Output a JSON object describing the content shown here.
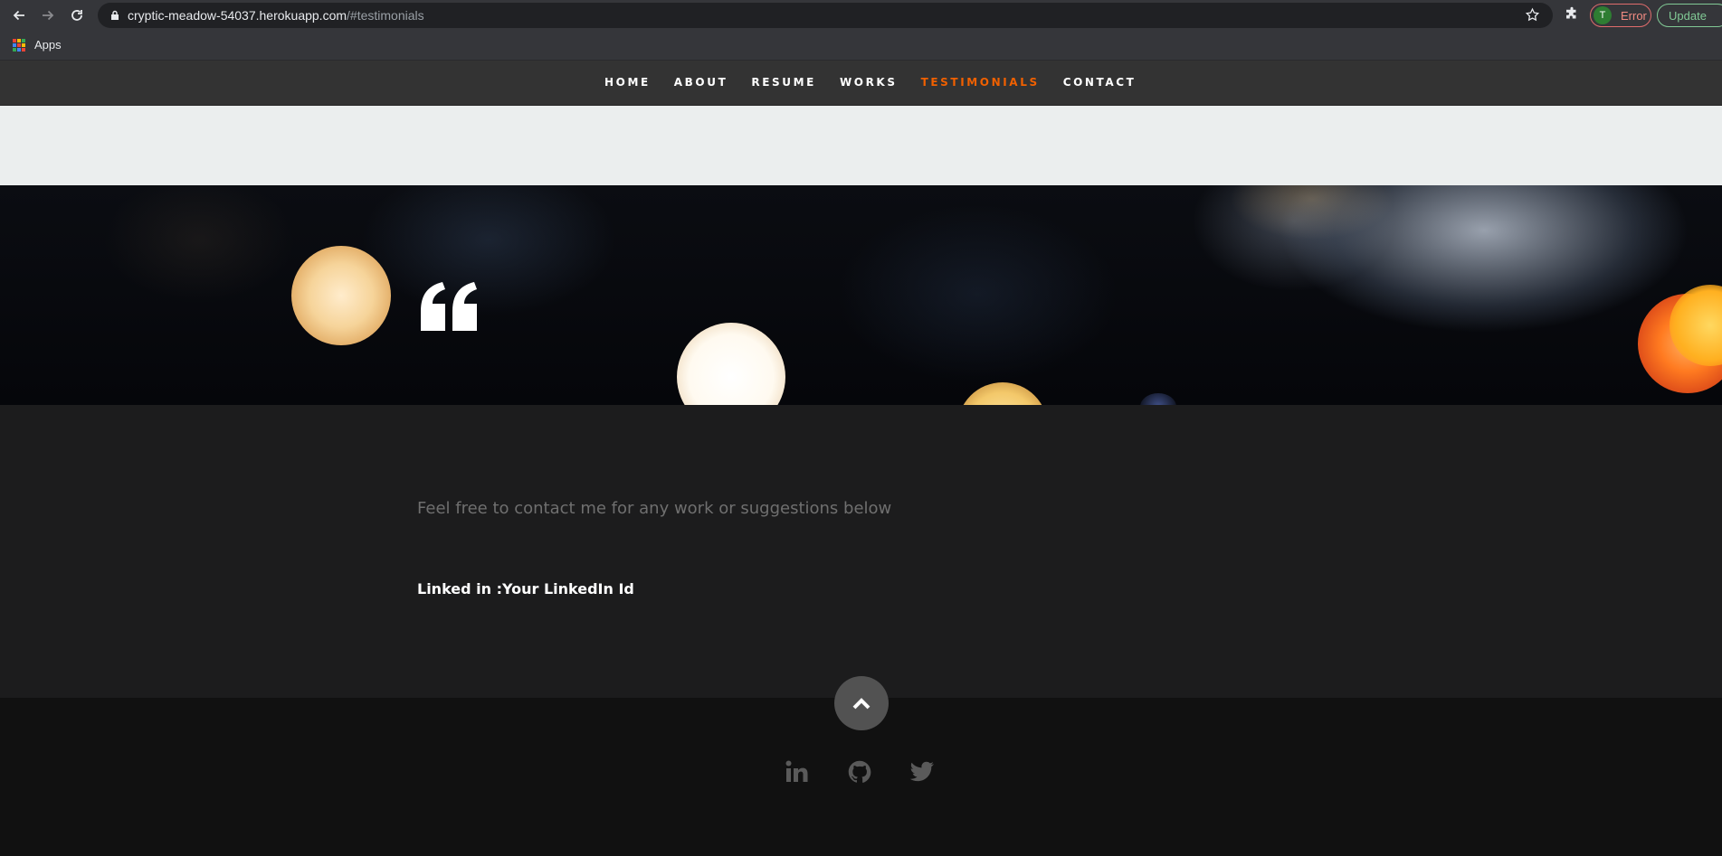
{
  "browser": {
    "url_host": "cryptic-meadow-54037.herokuapp.com",
    "url_path": "/#testimonials",
    "profile_initial": "T",
    "profile_status": "Error",
    "update_label": "Update",
    "bookmark_apps_label": "Apps"
  },
  "nav": {
    "items": [
      {
        "label": "HOME"
      },
      {
        "label": "ABOUT"
      },
      {
        "label": "RESUME"
      },
      {
        "label": "WORKS"
      },
      {
        "label": "TESTIMONIALS"
      },
      {
        "label": "CONTACT"
      }
    ],
    "active_index": 4,
    "active_color": "#f06000"
  },
  "content": {
    "intro_text": "Feel free to contact me for any work or suggestions below",
    "linkedin_line": "Linked in :Your LinkedIn Id"
  },
  "footer": {
    "social_icons": [
      "linkedin-icon",
      "github-icon",
      "twitter-icon"
    ],
    "go_top_icon": "chevron-up-icon"
  }
}
